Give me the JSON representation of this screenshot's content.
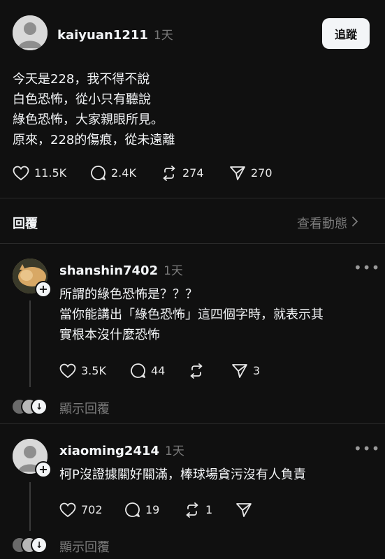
{
  "post": {
    "username": "kaiyuan1211",
    "time": "1天",
    "follow_label": "追蹤",
    "lines": [
      "今天是228，我不得不說",
      "白色恐怖，從小只有聽說",
      "綠色恐怖，大家親眼所見。",
      "原來，228的傷痕，從未遠離"
    ],
    "likes": "11.5K",
    "comments": "2.4K",
    "reposts": "274",
    "shares": "270"
  },
  "replies_bar": {
    "label": "回覆",
    "view_activity": "查看動態"
  },
  "replies": [
    {
      "username": "shanshin7402",
      "time": "1天",
      "lines": [
        "所謂的綠色恐怖是？？？",
        "當你能講出「綠色恐怖」這四個字時，就表示其",
        "實根本沒什麼恐怖"
      ],
      "likes": "3.5K",
      "comments": "44",
      "reposts": "",
      "shares": "3",
      "show_replies": "顯示回覆"
    },
    {
      "username": "xiaoming2414",
      "time": "1天",
      "lines": [
        "柯P沒證據關好關滿，棒球場貪污沒有人負責"
      ],
      "likes": "702",
      "comments": "19",
      "reposts": "1",
      "shares": "",
      "show_replies": "顯示回覆"
    }
  ],
  "icons": {
    "like": "heart-icon",
    "comment": "comment-bubble-icon",
    "repost": "repost-icon",
    "share": "send-icon",
    "more": "more-dots-icon",
    "chevron": "chevron-right-icon",
    "plus": "follow-plus-icon"
  }
}
